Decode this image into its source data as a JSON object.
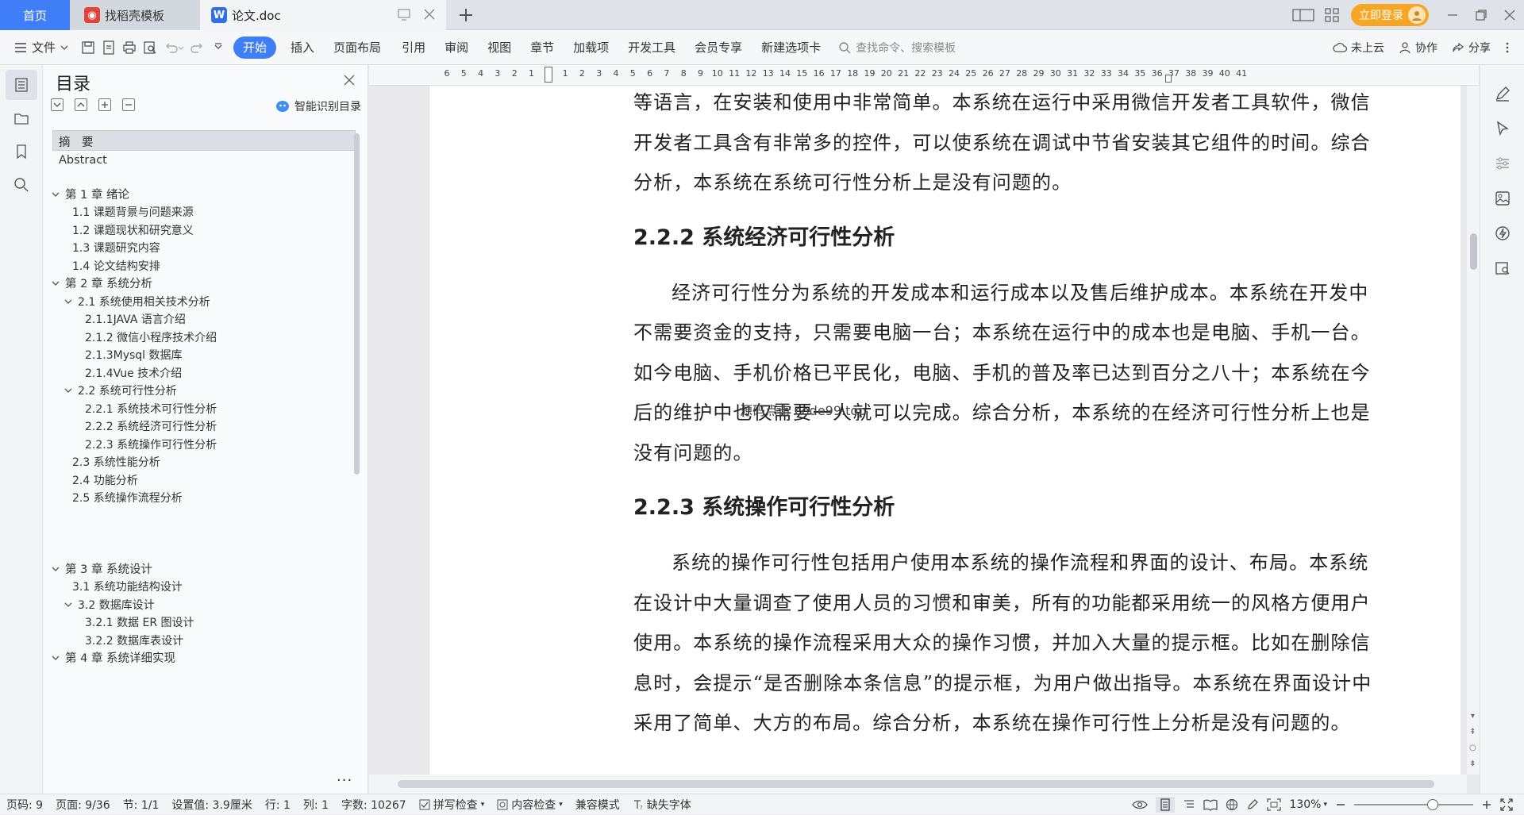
{
  "tabs": {
    "home": "首页",
    "templates": "找稻壳模板",
    "doc": "论文.doc"
  },
  "header": {
    "login": "立即登录"
  },
  "toolbar": {
    "file": "文件",
    "menus": [
      "开始",
      "插入",
      "页面布局",
      "引用",
      "审阅",
      "视图",
      "章节",
      "加载项",
      "开发工具",
      "会员专享",
      "新建选项卡"
    ],
    "search_placeholder": "查找命令、搜索模板",
    "cloud": "未上云",
    "collab": "协作",
    "share": "分享"
  },
  "toc": {
    "title": "目录",
    "smart": "智能识别目录",
    "more": "...",
    "items": [
      {
        "text": "摘　要",
        "level": 0,
        "chev": false
      },
      {
        "text": "Abstract",
        "level": 0,
        "chev": false
      },
      {
        "text": "第 1 章  绪论",
        "level": 0,
        "chev": true
      },
      {
        "text": "1.1 课题背景与问题来源",
        "level": 1,
        "chev": false
      },
      {
        "text": "1.2 课题现状和研究意义",
        "level": 1,
        "chev": false
      },
      {
        "text": "1.3 课题研究内容",
        "level": 1,
        "chev": false
      },
      {
        "text": "1.4 论文结构安排",
        "level": 1,
        "chev": false
      },
      {
        "text": "第 2 章  系统分析",
        "level": 0,
        "chev": true
      },
      {
        "text": "2.1 系统使用相关技术分析",
        "level": 1,
        "chev": true
      },
      {
        "text": "2.1.1JAVA 语言介绍",
        "level": 2,
        "chev": false
      },
      {
        "text": "2.1.2 微信小程序技术介绍",
        "level": 2,
        "chev": false
      },
      {
        "text": "2.1.3Mysql 数据库",
        "level": 2,
        "chev": false
      },
      {
        "text": "2.1.4Vue 技术介绍",
        "level": 2,
        "chev": false
      },
      {
        "text": "2.2 系统可行性分析",
        "level": 1,
        "chev": true
      },
      {
        "text": "2.2.1 系统技术可行性分析",
        "level": 2,
        "chev": false
      },
      {
        "text": "2.2.2 系统经济可行性分析",
        "level": 2,
        "chev": false
      },
      {
        "text": "2.2.3 系统操作可行性分析",
        "level": 2,
        "chev": false
      },
      {
        "text": "2.3 系统性能分析",
        "level": 1,
        "chev": false
      },
      {
        "text": "2.4 功能分析",
        "level": 1,
        "chev": false
      },
      {
        "text": "2.5 系统操作流程分析",
        "level": 1,
        "chev": false
      },
      {
        "text": "第 3 章  系统设计",
        "level": 0,
        "chev": true
      },
      {
        "text": "3.1 系统功能结构设计",
        "level": 1,
        "chev": false
      },
      {
        "text": "3.2 数据库设计",
        "level": 1,
        "chev": true
      },
      {
        "text": "3.2.1 数据 ER 图设计",
        "level": 2,
        "chev": false
      },
      {
        "text": "3.2.2 数据库表设计",
        "level": 2,
        "chev": false
      },
      {
        "text": "第 4 章  系统详细实现",
        "level": 0,
        "chev": true
      }
    ]
  },
  "ruler": [
    "6",
    "5",
    "4",
    "3",
    "2",
    "1",
    "",
    "1",
    "2",
    "3",
    "4",
    "5",
    "6",
    "7",
    "8",
    "9",
    "10",
    "11",
    "12",
    "13",
    "14",
    "15",
    "16",
    "17",
    "18",
    "19",
    "20",
    "21",
    "22",
    "23",
    "24",
    "25",
    "26",
    "27",
    "28",
    "29",
    "30",
    "31",
    "32",
    "33",
    "34",
    "35",
    "36",
    "37",
    "38",
    "39",
    "40",
    "41"
  ],
  "document": {
    "top_para": "等语言，在安装和使用中非常简单。本系统在运行中采用微信开发者工具软件，微信开发者工具含有非常多的控件，可以使系统在调试中节省安装其它组件的时间。综合分析，本系统在系统可行性分析上是没有问题的。",
    "h_econ": "2.2.2 系统经济可行性分析",
    "p_econ": "经济可行性分为系统的开发成本和运行成本以及售后维护成本。本系统在开发中不需要资金的支持，只需要电脑一台；本系统在运行中的成本也是电脑、手机一台。如今电脑、手机价格已平民化，电脑、手机的普及率已达到百分之八十；本系统在今后的维护中也仅需要一人就可以完成。综合分析，本系统的在经济可行性分析上也是没有问题的。",
    "h_oper": "2.2.3 系统操作可行性分析",
    "p_oper": "系统的操作可行性包括用户使用本系统的操作流程和界面的设计、布局。本系统在设计中大量调查了使用人员的习惯和审美，所有的功能都采用统一的风格方便用户使用。本系统的操作流程采用大众的操作习惯，并加入大量的提示框。比如在删除信息时，会提示“是否删除本条信息”的提示框，为用户做出指导。本系统在界面设计中采用了简单、大方的布局。综合分析，本系统在操作可行性上分析是没有问题的。",
    "watermark": "源码点击 code99.top"
  },
  "status": {
    "page_code": "页码: 9",
    "page": "页面: 9/36",
    "section": "节: 1/1",
    "setting": "设置值: 3.9厘米",
    "row": "行: 1",
    "col": "列: 1",
    "words": "字数: 10267",
    "spell": "拼写检查",
    "content_check": "内容检查",
    "compat": "兼容模式",
    "missing_font": "缺失字体",
    "zoom": "130%"
  },
  "colors": {
    "accent": "#3f7ef6",
    "login": "#f6a623"
  }
}
